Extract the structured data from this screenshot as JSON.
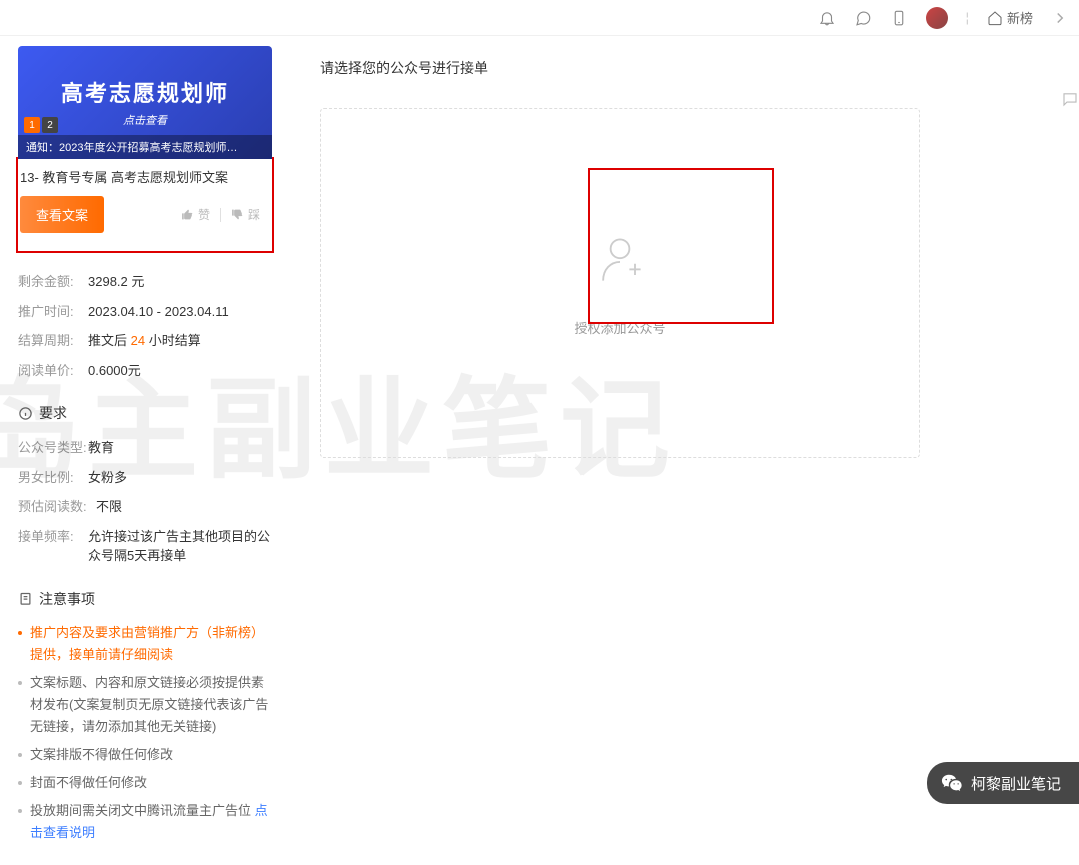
{
  "topnav": {
    "home_label": "新榜"
  },
  "card": {
    "banner_title": "高考志愿规划师",
    "banner_sub": "点击查看",
    "badge1": "1",
    "badge2": "2",
    "caption": "通知：2023年度公开招募高考志愿规划师…",
    "title": "13- 教育号专属 高考志愿规划师文案"
  },
  "actions": {
    "view_label": "查看文案",
    "like_label": "赞",
    "dislike_label": "踩"
  },
  "info": {
    "balance_label": "剩余金额:",
    "balance_value": "3298.2 元",
    "period_label": "推广时间:",
    "period_value": "2023.04.10 - 2023.04.11",
    "settle_label": "结算周期:",
    "settle_pre": "推文后 ",
    "settle_hours": "24",
    "settle_suf": " 小时结算",
    "price_label": "阅读单价:",
    "price_value": "0.6000元"
  },
  "req": {
    "header": "要求",
    "type_label": "公众号类型:",
    "type_value": "教育",
    "gender_label": "男女比例:",
    "gender_value": "女粉多",
    "reads_label": "预估阅读数:",
    "reads_value": "不限",
    "freq_label": "接单频率:",
    "freq_value": "允许接过该广告主其他项目的公众号隔5天再接单"
  },
  "notice": {
    "header": "注意事项",
    "items": [
      "推广内容及要求由营销推广方（非新榜）提供，接单前请仔细阅读",
      "文案标题、内容和原文链接必须按提供素材发布(文案复制页无原文链接代表该广告无链接，请勿添加其他无关链接)",
      "文案排版不得做任何修改",
      "封面不得做任何修改"
    ],
    "item5_pre": "投放期间需关闭文中腾讯流量主广告位",
    "item5_link": "点击查看说明"
  },
  "main": {
    "prompt": "请选择您的公众号进行接单",
    "auth_text": "授权添加公众号"
  },
  "watermark": "岛主副业笔记",
  "wechat": {
    "name": "柯黎副业笔记"
  }
}
